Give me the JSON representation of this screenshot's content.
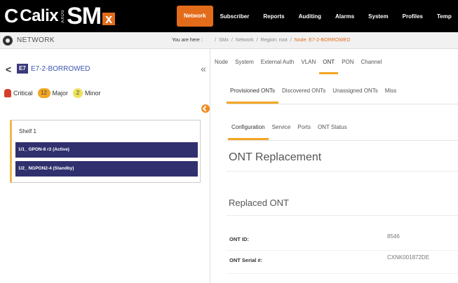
{
  "header": {
    "logo_text": "Calix",
    "logo_axos": "AXOS",
    "logo_sm": "SM",
    "logo_x": "x",
    "nav": [
      "Network",
      "Subscriber",
      "Reports",
      "Auditing",
      "Alarms",
      "System",
      "Profiles",
      "Temp"
    ],
    "active_nav": "Network",
    "brand_color": "#e36c1b"
  },
  "netbar": {
    "title": "NETWORK",
    "breadcrumb_prefix": "You are here :",
    "breadcrumbs": [
      "SMx",
      "Network",
      "Region: root"
    ],
    "breadcrumb_current": "Node: E7-2-BORROWED"
  },
  "left": {
    "back_icon": "chevron-left-icon",
    "device_badge": "E7",
    "device_name": "E7-2-BORROWED",
    "collapse_icon": "double-chevron-left-icon",
    "alarms": {
      "critical_label": "Critical",
      "major_count": "12",
      "major_label": "Major",
      "minor_count": "2",
      "minor_label": "Minor"
    },
    "shelf_title": "Shelf 1",
    "cards": [
      "1/1_ GPON-8 r2 (Active)",
      "1/2_ NGPON2-4 (Standby)"
    ]
  },
  "right": {
    "tabs_level1": [
      "Node",
      "System",
      "External Auth",
      "VLAN",
      "ONT",
      "PON",
      "Channel"
    ],
    "tabs_level1_active": "ONT",
    "tabs_level2": [
      "Provisioned ONTs",
      "Discovered ONTs",
      "Unassigned ONTs",
      "Miss"
    ],
    "tabs_level2_active": "Provisioned ONTs",
    "tabs_level3": [
      "Configuration",
      "Service",
      "Ports",
      "ONT Status"
    ],
    "tabs_level3_active": "Configuration",
    "section_title": "ONT Replacement",
    "subsection_title": "Replaced ONT",
    "fields": {
      "ont_id_label": "ONT ID:",
      "ont_id_value": "8546",
      "serial_label": "ONT Serial #:",
      "serial_value": "CXNK001872DE"
    }
  }
}
